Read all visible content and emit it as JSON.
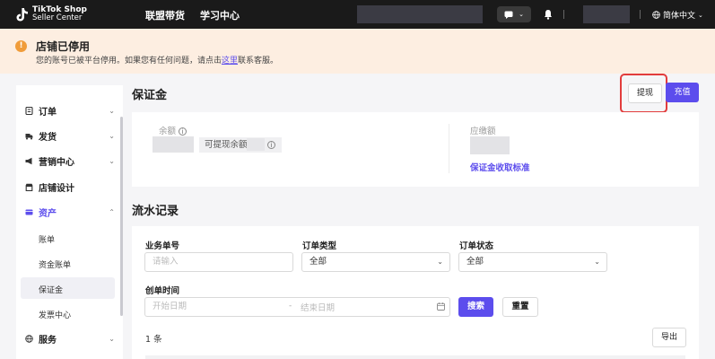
{
  "brand": {
    "line1": "TikTok Shop",
    "line2": "Seller Center"
  },
  "topnav": {
    "items": [
      "联盟带货",
      "学习中心"
    ],
    "language": "简体中文"
  },
  "banner": {
    "title": "店铺已停用",
    "text_before": "您的账号已被平台停用。如果您有任何问题，请点击",
    "link": "这里",
    "text_after": "联系客服。"
  },
  "sidebar": {
    "items": [
      {
        "label": "订单",
        "icon": "order-icon"
      },
      {
        "label": "发货",
        "icon": "truck-icon"
      },
      {
        "label": "营销中心",
        "icon": "megaphone-icon"
      },
      {
        "label": "店铺设计",
        "icon": "store-icon"
      },
      {
        "label": "资产",
        "icon": "wallet-icon"
      },
      {
        "label": "服务",
        "icon": "globe-icon"
      }
    ],
    "sub_items": [
      "账单",
      "资金账单",
      "保证金",
      "发票中心"
    ]
  },
  "deposit": {
    "title": "保证金",
    "withdraw_label": "提现",
    "recharge_label": "充值",
    "balance_label": "余额",
    "available_label": "可提现余额:",
    "payable_label": "应缴额",
    "standard_link": "保证金收取标准"
  },
  "records": {
    "title": "流水记录",
    "order_no_label": "业务单号",
    "order_no_placeholder": "请输入",
    "order_type_label": "订单类型",
    "order_type_value": "全部",
    "order_status_label": "订单状态",
    "order_status_value": "全部",
    "created_label": "创单时间",
    "start_placeholder": "开始日期",
    "date_separator": "-",
    "end_placeholder": "结束日期",
    "search_label": "搜索",
    "reset_label": "重置",
    "count": "1 条",
    "export_label": "导出"
  },
  "colors": {
    "accent": "#5c4ded",
    "nav_bg": "#1a1a1a",
    "banner_bg": "#fdeee1",
    "warning": "#f09c3a",
    "highlight": "#e23c3c"
  }
}
